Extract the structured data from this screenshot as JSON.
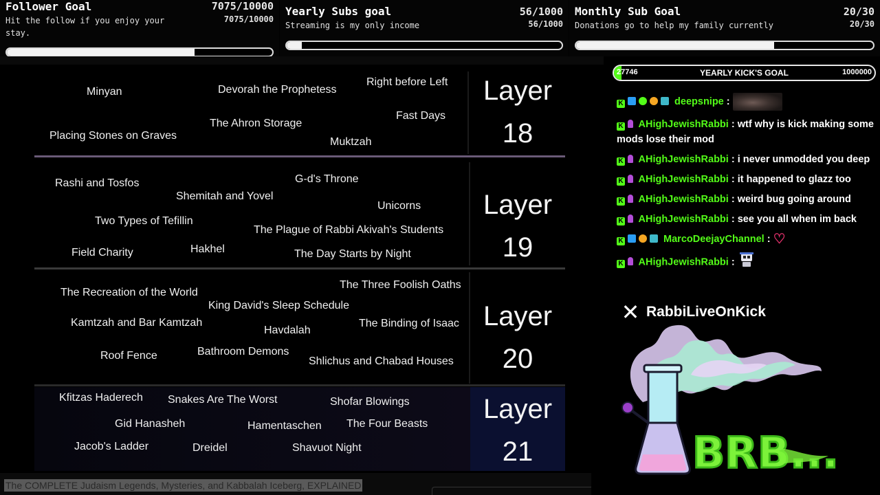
{
  "goals": [
    {
      "title": "Follower Goal",
      "count": "7075/10000",
      "description": "Hit the follow if you enjoy your stay.",
      "count_small": "7075/10000",
      "progress": 0.7075
    },
    {
      "title": "Yearly Subs goal",
      "count": "56/1000",
      "description": "Streaming is my only income",
      "count_small": "56/1000",
      "progress": 0.056
    },
    {
      "title": "Monthly Sub Goal",
      "count": "20/30",
      "description": "Donations go to help my family currently",
      "count_small": "20/30",
      "progress": 0.667
    }
  ],
  "iceberg": {
    "layer_word": "Layer",
    "layers": [
      {
        "number": "18",
        "items": [
          "Minyan",
          "Devorah the Prophetess",
          "Right before Left",
          "Fast Days",
          "The Ahron Storage",
          "Placing Stones on Graves",
          "Muktzah"
        ]
      },
      {
        "number": "19",
        "items": [
          "Rashi and Tosfos",
          "G-d's Throne",
          "Shemitah and Yovel",
          "Unicorns",
          "Two Types of Tefillin",
          "The Plague of Rabbi Akivah's Students",
          "Field Charity",
          "Hakhel",
          "The Day Starts by Night"
        ]
      },
      {
        "number": "20",
        "items": [
          "The Three Foolish Oaths",
          "The Recreation of the World",
          "King David's Sleep Schedule",
          "Kamtzah and Bar Kamtzah",
          "The Binding of Isaac",
          "Havdalah",
          "Roof Fence",
          "Bathroom Demons",
          "Shlichus and Chabad Houses"
        ]
      },
      {
        "number": "21",
        "items": [
          "Kfitzas Haderech",
          "Snakes Are The Worst",
          "Shofar Blowings",
          "Gid Hanasheh",
          "Hamentaschen",
          "The Four Beasts",
          "Jacob's Ladder",
          "Dreidel",
          "Shavuot Night"
        ]
      }
    ]
  },
  "video_caption": "The COMPLETE Judaism Legends, Mysteries, and Kabbalah Iceberg, EXPLAINED",
  "kick_goal": {
    "current": "27746",
    "title": "YEARLY KICK'S GOAL",
    "target": "1000000",
    "progress": 0.027746
  },
  "chat": [
    {
      "user": "deepsnipe",
      "text": "",
      "badges": [
        "kick",
        "vip",
        "verified",
        "gift",
        "sub"
      ],
      "emote": "photo"
    },
    {
      "user": "AHighJewishRabbi",
      "text": "wtf why is kick making some mods lose their mod",
      "badges": [
        "kick",
        "mod"
      ]
    },
    {
      "user": "AHighJewishRabbi",
      "text": "i never unmodded you deep",
      "badges": [
        "kick",
        "mod"
      ]
    },
    {
      "user": "AHighJewishRabbi",
      "text": "it happened to glazz too",
      "badges": [
        "kick",
        "mod"
      ]
    },
    {
      "user": "AHighJewishRabbi",
      "text": "weird bug going around",
      "badges": [
        "kick",
        "mod"
      ]
    },
    {
      "user": "AHighJewishRabbi",
      "text": "see you all when im back",
      "badges": [
        "kick",
        "mod"
      ]
    },
    {
      "user": "MarcoDeejayChannel",
      "text": "",
      "badges": [
        "kick",
        "vip",
        "gift",
        "sub"
      ],
      "emote": "heart"
    },
    {
      "user": "AHighJewishRabbi",
      "text": "",
      "badges": [
        "kick",
        "mod"
      ],
      "emote": "robot"
    }
  ],
  "social": {
    "platform_icon": "x-logo-icon",
    "handle": "RabbiLiveOnKick"
  },
  "colors": {
    "kick_green": "#53fc18",
    "background": "#000000",
    "layer21_bg": "#0b1030"
  }
}
